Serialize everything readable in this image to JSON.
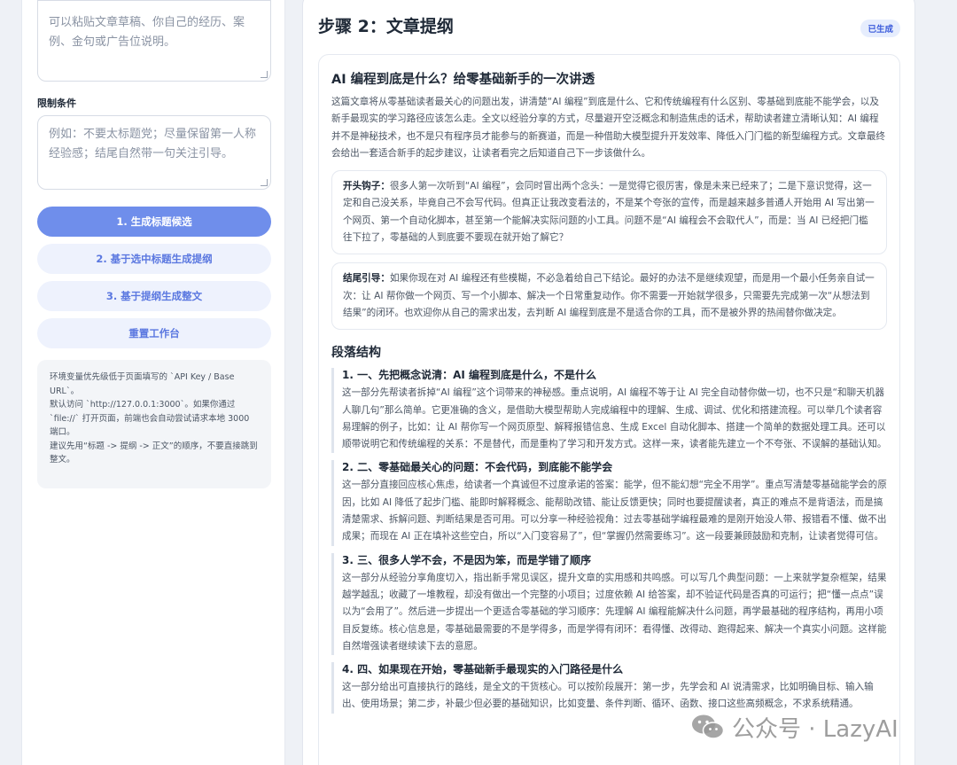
{
  "left": {
    "source_placeholder": "可以粘贴文章草稿、你自己的经历、案例、金句或广告位说明。",
    "constraints_label": "限制条件",
    "constraints_placeholder": "例如：不要太标题党；尽量保留第一人称经验感；结尾自然带一句关注引导。",
    "buttons": {
      "generate_titles": "1. 生成标题候选",
      "generate_outline": "2. 基于选中标题生成提纲",
      "generate_article": "3. 基于提纲生成整文",
      "reset": "重置工作台"
    },
    "notes": [
      "环境变量优先级低于页面填写的 `API Key / Base URL`。",
      "默认访问 `http://127.0.0.1:3000`。如果你通过 `file://` 打开页面，前端也会自动尝试请求本地 3000 端口。",
      "建议先用“标题 -> 提纲 -> 正文”的顺序，不要直接跳到整文。"
    ]
  },
  "right": {
    "step_title": "步骤 2：文章提纲",
    "status_badge": "已生成",
    "doc_title": "AI 编程到底是什么？给零基础新手的一次讲透",
    "summary": "这篇文章将从零基础读者最关心的问题出发，讲清楚“AI 编程”到底是什么、它和传统编程有什么区别、零基础到底能不能学会，以及新手最现实的学习路径应该怎么走。全文以经验分享的方式，尽量避开空泛概念和制造焦虑的话术，帮助读者建立清晰认知：AI 编程并不是神秘技术，也不是只有程序员才能参与的新赛道，而是一种借助大模型提升开发效率、降低入门门槛的新型编程方式。文章最终会给出一套适合新手的起步建议，让读者看完之后知道自己下一步该做什么。",
    "hook_label": "开头钩子：",
    "hook_text": "很多人第一次听到“AI 编程”，会同时冒出两个念头：一是觉得它很厉害，像是未来已经来了；二是下意识觉得，这一定和自己没关系，毕竟自己不会写代码。但真正让我改变看法的，不是某个夸张的宣传，而是越来越多普通人开始用 AI 写出第一个网页、第一个自动化脚本，甚至第一个能解决实际问题的小工具。问题不是“AI 编程会不会取代人”，而是：当 AI 已经把门槛往下拉了，零基础的人到底要不要现在就开始了解它？",
    "ending_label": "结尾引导：",
    "ending_text": "如果你现在对 AI 编程还有些模糊，不必急着给自己下结论。最好的办法不是继续观望，而是用一个最小任务亲自试一次：让 AI 帮你做一个网页、写一个小脚本、解决一个日常重复动作。你不需要一开始就学很多，只需要先完成第一次“从想法到结果”的闭环。也欢迎你从自己的需求出发，去判断 AI 编程到底是不是适合你的工具，而不是被外界的热闹替你做决定。",
    "section_heading": "段落结构",
    "paragraphs": [
      {
        "title": "1. 一、先把概念说清：AI 编程到底是什么，不是什么",
        "body": "这一部分先帮读者拆掉“AI 编程”这个词带来的神秘感。重点说明，AI 编程不等于让 AI 完全自动替你做一切，也不只是“和聊天机器人聊几句”那么简单。它更准确的含义，是借助大模型帮助人完成编程中的理解、生成、调试、优化和搭建流程。可以举几个读者容易理解的例子，比如：让 AI 帮你写一个网页原型、解释报错信息、生成 Excel 自动化脚本、搭建一个简单的数据处理工具。还可以顺带说明它和传统编程的关系：不是替代，而是重构了学习和开发方式。这样一来，读者能先建立一个不夸张、不误解的基础认知。"
      },
      {
        "title": "2. 二、零基础最关心的问题：不会代码，到底能不能学会",
        "body": "这一部分直接回应核心焦虑，给读者一个真诚但不过度承诺的答案：能学，但不能幻想“完全不用学”。重点写清楚零基础能学会的原因，比如 AI 降低了起步门槛、能即时解释概念、能帮助改错、能让反馈更快；同时也要提醒读者，真正的难点不是背语法，而是搞清楚需求、拆解问题、判断结果是否可用。可以分享一种经验视角：过去零基础学编程最难的是刚开始没人带、报错看不懂、做不出成果；而现在 AI 正在填补这些空白，所以“入门变容易了”，但“掌握仍然需要练习”。这一段要兼顾鼓励和克制，让读者觉得可信。"
      },
      {
        "title": "3. 三、很多人学不会，不是因为笨，而是学错了顺序",
        "body": "这一部分从经验分享角度切入，指出新手常见误区，提升文章的实用感和共鸣感。可以写几个典型问题：一上来就学复杂框架，结果越学越乱；收藏了一堆教程，却没有做出一个完整的小项目；过度依赖 AI 给答案，却不验证代码是否真的可运行；把“懂一点点”误以为“会用了”。然后进一步提出一个更适合零基础的学习顺序：先理解 AI 编程能解决什么问题，再学最基础的程序结构，再用小项目反复练。核心信息是，零基础最需要的不是学得多，而是学得有闭环：看得懂、改得动、跑得起来、解决一个真实小问题。这样能自然增强读者继续读下去的意愿。"
      },
      {
        "title": "4. 四、如果现在开始，零基础新手最现实的入门路径是什么",
        "body": "这一部分给出可直接执行的路线，是全文的干货核心。可以按阶段展开：第一步，先学会和 AI 说清需求，比如明确目标、输入输出、使用场景；第二步，补最少但必要的基础知识，比如变量、条件判断、循环、函数、接口这些高频概念，不求系统精通。"
      }
    ]
  },
  "watermark": {
    "text": "公众号 · LazyAI",
    "icon": "wechat-icon"
  }
}
